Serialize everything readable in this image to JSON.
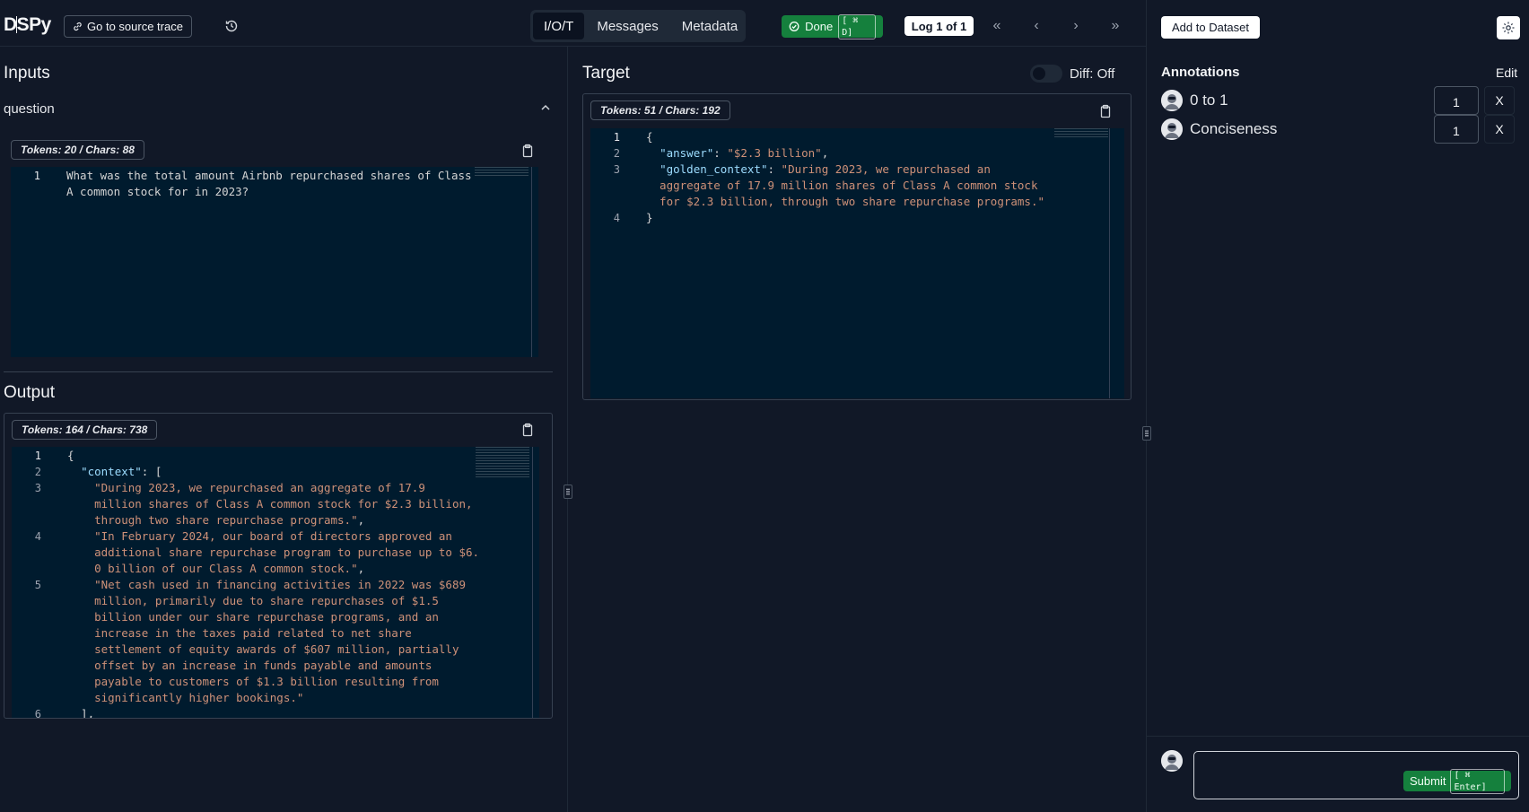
{
  "header": {
    "logo": "DSPy",
    "source_trace_label": "Go to source trace",
    "tabs": [
      {
        "label": "I/O/T",
        "active": true
      },
      {
        "label": "Messages",
        "active": false
      },
      {
        "label": "Metadata",
        "active": false
      }
    ],
    "status": {
      "label": "Done",
      "shortcut": "[ ⌘ D]",
      "color": "#15803d"
    },
    "log_counter": "Log 1 of 1",
    "nav": {
      "first": "«",
      "prev": "‹",
      "next": "›",
      "last": "»"
    }
  },
  "inputs": {
    "title": "Inputs",
    "field_name": "question",
    "badge": "Tokens: 20 / Chars: 88",
    "lines": [
      {
        "n": "1",
        "text": "What was the total amount Airbnb repurchased shares of Class"
      },
      {
        "n": "",
        "text": "A common stock for in 2023?"
      }
    ]
  },
  "output": {
    "title": "Output",
    "badge": "Tokens: 164 / Chars: 738",
    "lines": [
      {
        "n": "1",
        "parts": [
          [
            "punc",
            "{"
          ]
        ]
      },
      {
        "n": "2",
        "parts": [
          [
            "punc",
            "  "
          ],
          [
            "key",
            "\"context\""
          ],
          [
            "punc",
            ": ["
          ]
        ]
      },
      {
        "n": "3",
        "parts": [
          [
            "str",
            "    \"During 2023, we repurchased an aggregate of 17.9"
          ]
        ]
      },
      {
        "n": "",
        "parts": [
          [
            "str",
            "    million shares of Class A common stock for $2.3 billion,"
          ]
        ]
      },
      {
        "n": "",
        "parts": [
          [
            "str",
            "    through two share repurchase programs.\""
          ],
          [
            "punc",
            ","
          ]
        ]
      },
      {
        "n": "4",
        "parts": [
          [
            "str",
            "    \"In February 2024, our board of directors approved an"
          ]
        ]
      },
      {
        "n": "",
        "parts": [
          [
            "str",
            "    additional share repurchase program to purchase up to $6."
          ]
        ]
      },
      {
        "n": "",
        "parts": [
          [
            "str",
            "    0 billion of our Class A common stock.\""
          ],
          [
            "punc",
            ","
          ]
        ]
      },
      {
        "n": "5",
        "parts": [
          [
            "str",
            "    \"Net cash used in financing activities in 2022 was $689"
          ]
        ]
      },
      {
        "n": "",
        "parts": [
          [
            "str",
            "    million, primarily due to share repurchases of $1.5"
          ]
        ]
      },
      {
        "n": "",
        "parts": [
          [
            "str",
            "    billion under our share repurchase programs, and an"
          ]
        ]
      },
      {
        "n": "",
        "parts": [
          [
            "str",
            "    increase in the taxes paid related to net share"
          ]
        ]
      },
      {
        "n": "",
        "parts": [
          [
            "str",
            "    settlement of equity awards of $607 million, partially"
          ]
        ]
      },
      {
        "n": "",
        "parts": [
          [
            "str",
            "    offset by an increase in funds payable and amounts"
          ]
        ]
      },
      {
        "n": "",
        "parts": [
          [
            "str",
            "    payable to customers of $1.3 billion resulting from"
          ]
        ]
      },
      {
        "n": "",
        "parts": [
          [
            "str",
            "    significantly higher bookings.\""
          ]
        ]
      },
      {
        "n": "6",
        "parts": [
          [
            "punc",
            "  ],"
          ]
        ]
      }
    ]
  },
  "target": {
    "title": "Target",
    "diff_label": "Diff: Off",
    "badge": "Tokens: 51 / Chars: 192",
    "lines": [
      {
        "n": "1",
        "parts": [
          [
            "punc",
            "{"
          ]
        ]
      },
      {
        "n": "2",
        "parts": [
          [
            "punc",
            "  "
          ],
          [
            "key",
            "\"answer\""
          ],
          [
            "punc",
            ": "
          ],
          [
            "str",
            "\"$2.3 billion\""
          ],
          [
            "punc",
            ","
          ]
        ]
      },
      {
        "n": "3",
        "parts": [
          [
            "punc",
            "  "
          ],
          [
            "key",
            "\"golden_context\""
          ],
          [
            "punc",
            ": "
          ],
          [
            "str",
            "\"During 2023, we repurchased an"
          ]
        ]
      },
      {
        "n": "",
        "parts": [
          [
            "str",
            "  aggregate of 17.9 million shares of Class A common stock"
          ]
        ]
      },
      {
        "n": "",
        "parts": [
          [
            "str",
            "  for $2.3 billion, through two share repurchase programs.\""
          ]
        ]
      },
      {
        "n": "4",
        "parts": [
          [
            "punc",
            "}"
          ]
        ]
      }
    ]
  },
  "annotations": {
    "add_dataset_label": "Add to Dataset",
    "title": "Annotations",
    "edit_label": "Edit",
    "items": [
      {
        "name": "0 to 1",
        "value": "1",
        "remove": "X"
      },
      {
        "name": "Conciseness",
        "value": "1",
        "remove": "X"
      }
    ],
    "submit_label": "Submit",
    "submit_shortcut": "[ ⌘ Enter]"
  }
}
